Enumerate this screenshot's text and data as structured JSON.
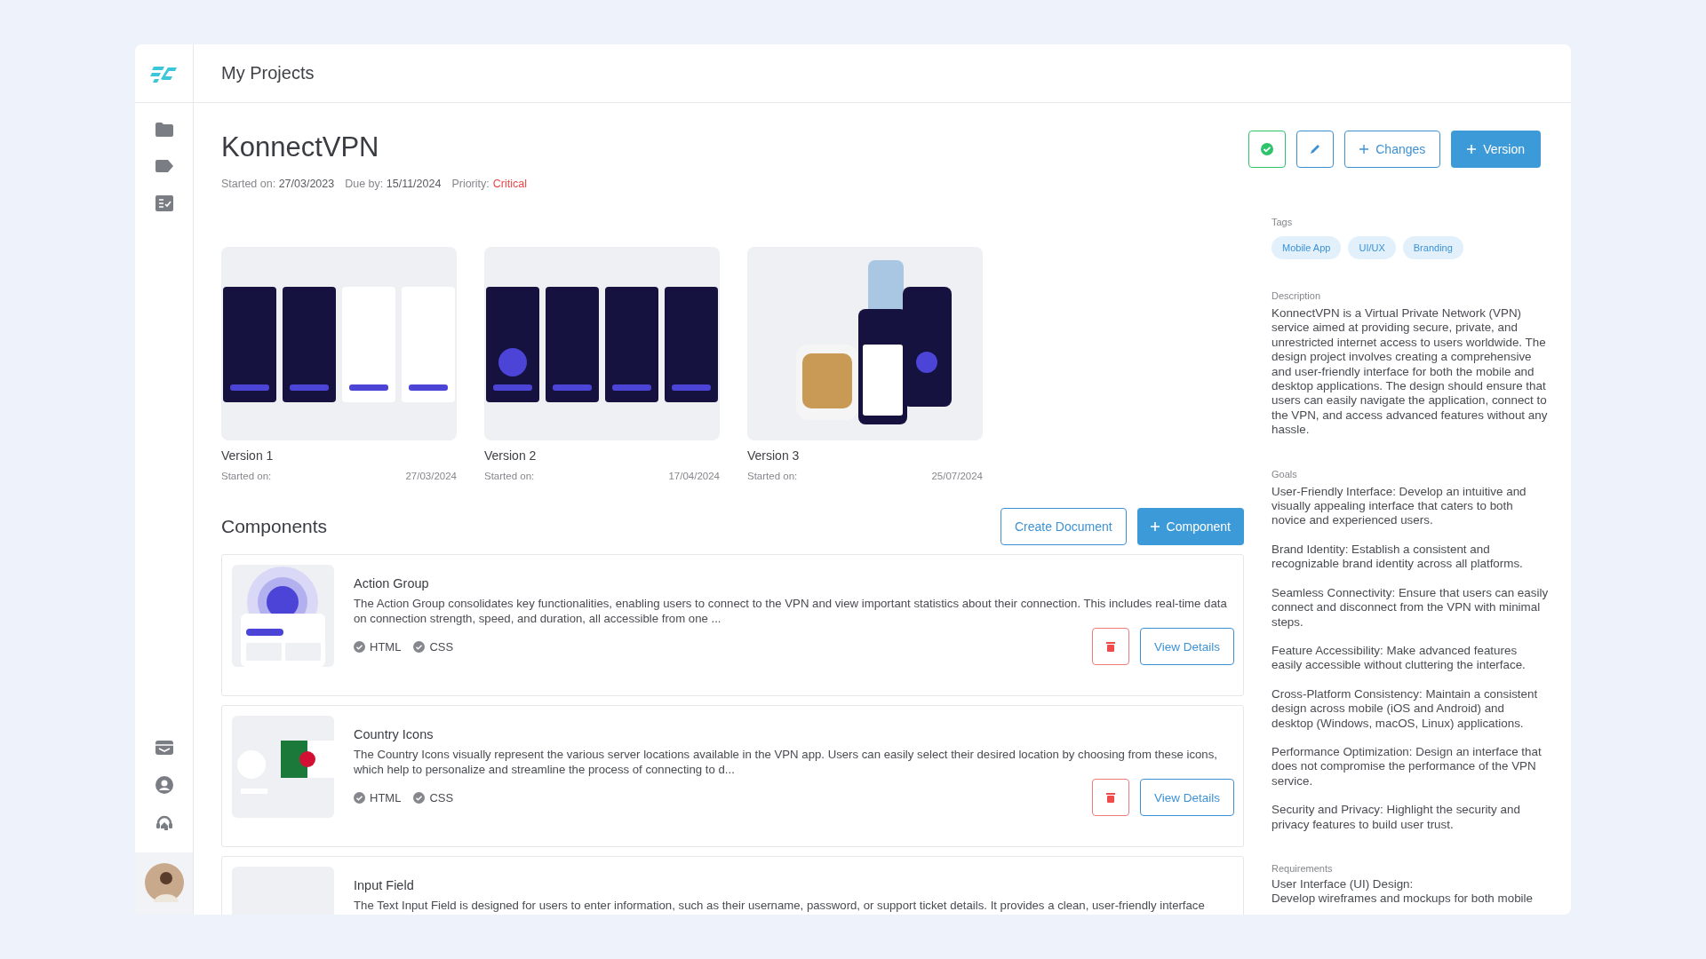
{
  "header": {
    "title": "My Projects"
  },
  "project": {
    "name": "KonnectVPN",
    "started_label": "Started on:",
    "started": "27/03/2023",
    "due_label": "Due by:",
    "due": "15/11/2024",
    "priority_label": "Priority:",
    "priority": "Critical"
  },
  "actions": {
    "changes": "Changes",
    "version": "Version"
  },
  "versions": [
    {
      "title": "Version 1",
      "started_label": "Started on:",
      "date": "27/03/2024"
    },
    {
      "title": "Version 2",
      "started_label": "Started on:",
      "date": "17/04/2024"
    },
    {
      "title": "Version 3",
      "started_label": "Started on:",
      "date": "25/07/2024"
    }
  ],
  "components": {
    "title": "Components",
    "create_document": "Create Document",
    "add_component": "Component",
    "items": [
      {
        "name": "Action Group",
        "description": "The Action Group consolidates key functionalities, enabling users to connect to the VPN and view important statistics about their connection. This includes real-time data on connection strength, speed, and duration, all accessible from one ...",
        "techs": [
          "HTML",
          "CSS"
        ],
        "details": "View Details"
      },
      {
        "name": "Country Icons",
        "description": "The Country Icons visually represent the various server locations available in the VPN app. Users can easily select their desired location by choosing from these icons, which help to personalize and streamline the process of connecting to d...",
        "techs": [
          "HTML",
          "CSS"
        ],
        "details": "View Details"
      },
      {
        "name": "Input Field",
        "description": "The Text Input Field is designed for users to enter information, such as their username, password, or support ticket details. It provides a clean, user-friendly interface"
      }
    ]
  },
  "details": {
    "tags_label": "Tags",
    "tags": [
      "Mobile App",
      "UI/UX",
      "Branding"
    ],
    "description_label": "Description",
    "description": "KonnectVPN is a Virtual Private Network (VPN) service aimed at providing secure, private, and unrestricted internet access to users worldwide. The design project involves creating a comprehensive and user-friendly interface for both the mobile and desktop applications. The design should ensure that users can easily navigate the application, connect to the VPN, and access advanced features without any hassle.",
    "goals_label": "Goals",
    "goals": [
      "User-Friendly Interface: Develop an intuitive and visually appealing interface that caters to both novice and experienced users.",
      "Brand Identity: Establish a consistent and recognizable brand identity across all platforms.",
      "Seamless Connectivity: Ensure that users can easily connect and disconnect from the VPN with minimal steps.",
      "Feature Accessibility: Make advanced features easily accessible without cluttering the interface.",
      "Cross-Platform Consistency: Maintain a consistent design across mobile (iOS and Android) and desktop (Windows, macOS, Linux) applications.",
      "Performance Optimization: Design an interface that does not compromise the performance of the VPN service.",
      "Security and Privacy: Highlight the security and privacy features to build user trust."
    ],
    "requirements_label": "Requirements",
    "requirements": [
      "User Interface (UI) Design:",
      "Develop wireframes and mockups for both mobile"
    ]
  }
}
